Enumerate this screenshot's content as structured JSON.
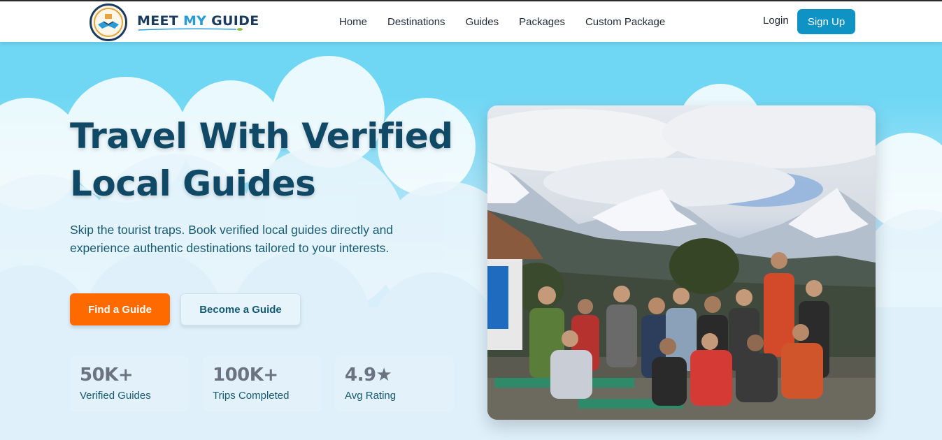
{
  "header": {
    "logo_text_1": "MEET ",
    "logo_text_2": "MY",
    "logo_text_3": " GUIDE",
    "nav": [
      "Home",
      "Destinations",
      "Guides",
      "Packages",
      "Custom Package"
    ],
    "login": "Login",
    "signup": "Sign Up"
  },
  "hero": {
    "headline_line1": "Travel With Verified",
    "headline_line2": "Local Guides",
    "subtitle": "Skip the tourist traps. Book verified local guides directly and experience authentic destinations tailored to your interests.",
    "find_button": "Find a Guide",
    "become_button": "Become a Guide",
    "stats": [
      {
        "value": "50K+",
        "label": "Verified Guides"
      },
      {
        "value": "100K+",
        "label": "Trips Completed"
      },
      {
        "value": "4.9★",
        "label": "Avg Rating"
      }
    ]
  },
  "colors": {
    "brand_dark": "#1b3b5e",
    "brand_blue": "#0f92c4",
    "accent_orange": "#ff6a00",
    "sky": "#6fd7f4"
  }
}
